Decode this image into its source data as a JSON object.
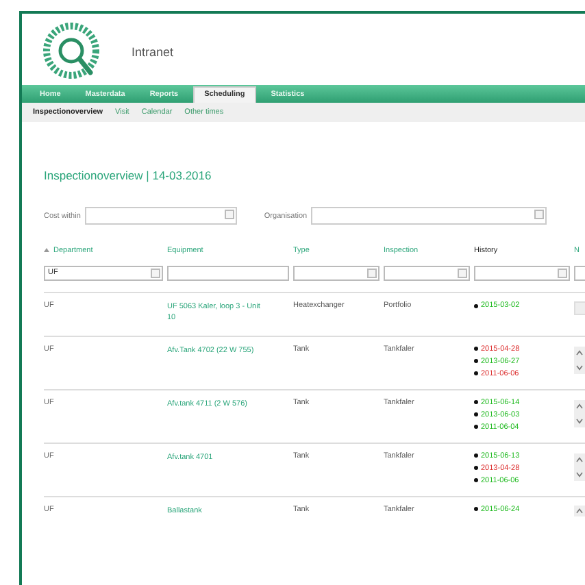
{
  "header": {
    "title": "Intranet"
  },
  "menu": [
    {
      "label": "Home",
      "selected": false
    },
    {
      "label": "Masterdata",
      "selected": false
    },
    {
      "label": "Reports",
      "selected": false
    },
    {
      "label": "Scheduling",
      "selected": true
    },
    {
      "label": "Statistics",
      "selected": false
    }
  ],
  "submenu": [
    {
      "label": "Inspectionoverview",
      "selected": true
    },
    {
      "label": "Visit",
      "selected": false
    },
    {
      "label": "Calendar",
      "selected": false
    },
    {
      "label": "Other times",
      "selected": false
    }
  ],
  "page_title": "Inspectionoverview | 14-03.2016",
  "filters": [
    {
      "label": "Cost within"
    },
    {
      "label": "Organisation"
    }
  ],
  "table": {
    "columns": [
      {
        "label": "Department",
        "sorted": true,
        "link": true
      },
      {
        "label": "Equipment",
        "sorted": false,
        "link": true
      },
      {
        "label": "Type",
        "sorted": false,
        "link": true
      },
      {
        "label": "Inspection",
        "sorted": false,
        "link": true
      },
      {
        "label": "History",
        "sorted": false,
        "link": false
      },
      {
        "label": "N",
        "sorted": false,
        "link": true
      }
    ],
    "filter_row": [
      {
        "kind": "select",
        "value": "UF"
      },
      {
        "kind": "text"
      },
      {
        "kind": "select"
      },
      {
        "kind": "select"
      },
      {
        "kind": "select"
      },
      {
        "kind": "text"
      }
    ],
    "rows": [
      {
        "department": "UF",
        "equipment": "UF 5063 Kaler, loop 3 - Unit 10",
        "type": "Heatexchanger",
        "inspection": "Portfolio",
        "history": [
          {
            "date": "2015-03-02",
            "color": "#22bb22"
          }
        ],
        "scroller": {
          "kind": "box"
        }
      },
      {
        "department": "UF",
        "equipment": "Afv.Tank 4702 (22 W 755)",
        "type": "Tank",
        "inspection": "Tankfaler",
        "history": [
          {
            "date": "2015-04-28",
            "color": "#dd3333"
          },
          {
            "date": "2013-06-27",
            "color": "#22bb22"
          },
          {
            "date": "2011-06-06",
            "color": "#dd3333"
          }
        ],
        "scroller": {
          "kind": "updown"
        }
      },
      {
        "department": "UF",
        "equipment": "Afv.tank 4711 (2 W 576)",
        "type": "Tank",
        "inspection": "Tankfaler",
        "history": [
          {
            "date": "2015-06-14",
            "color": "#22bb22"
          },
          {
            "date": "2013-06-03",
            "color": "#22bb22"
          },
          {
            "date": "2011-06-04",
            "color": "#22bb22"
          }
        ],
        "scroller": {
          "kind": "updown"
        }
      },
      {
        "department": "UF",
        "equipment": "Afv.tank 4701",
        "type": "Tank",
        "inspection": "Tankfaler",
        "history": [
          {
            "date": "2015-06-13",
            "color": "#22bb22"
          },
          {
            "date": "2013-04-28",
            "color": "#dd3333"
          },
          {
            "date": "2011-06-06",
            "color": "#22bb22"
          }
        ],
        "scroller": {
          "kind": "updown"
        }
      },
      {
        "department": "UF",
        "equipment": "Ballastank",
        "type": "Tank",
        "inspection": "Tankfaler",
        "history": [
          {
            "date": "2015-06-24",
            "color": "#22bb22"
          }
        ],
        "scroller": {
          "kind": "up"
        }
      }
    ]
  }
}
